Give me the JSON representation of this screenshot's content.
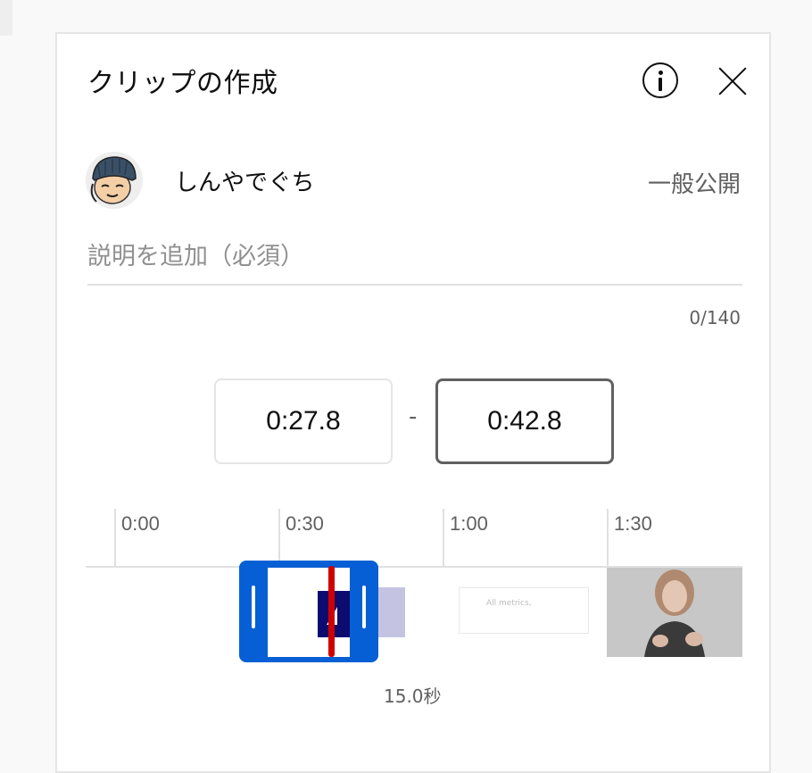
{
  "dialog": {
    "title": "クリップの作成",
    "info_icon": "info-icon",
    "close_icon": "close-icon"
  },
  "channel": {
    "name": "しんやでぐち",
    "visibility": "一般公開"
  },
  "description": {
    "placeholder": "説明を追加（必須）",
    "value": "",
    "counter": "0/140"
  },
  "clip": {
    "start_time": "0:27.8",
    "separator": "-",
    "end_time": "0:42.8",
    "duration": "15.0秒"
  },
  "timeline": {
    "labels": [
      "0:00",
      "0:30",
      "1:00",
      "1:30"
    ],
    "thumbnail_text": "All metrics,"
  },
  "colors": {
    "accent": "#065fd4",
    "playhead": "#d00000",
    "text_primary": "#0f0f0f",
    "text_secondary": "#606060"
  }
}
